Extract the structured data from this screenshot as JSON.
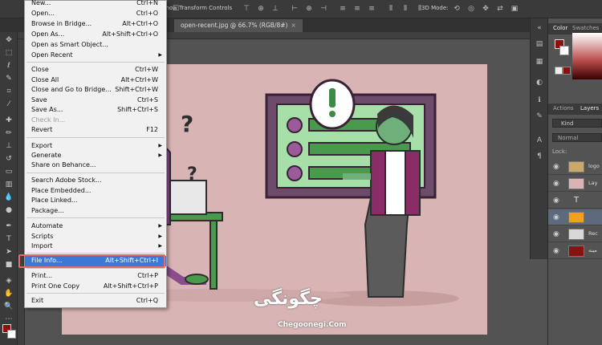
{
  "options_bar": {
    "label": "Show Transform Controls",
    "mode3d": "3D Mode:"
  },
  "document_tab": {
    "label": "open-recent.jpg @ 66.7% (RGB/8#)",
    "close": "×"
  },
  "file_menu": {
    "items": [
      {
        "label": "New...",
        "shortcut": "Ctrl+N"
      },
      {
        "label": "Open...",
        "shortcut": "Ctrl+O"
      },
      {
        "label": "Browse in Bridge...",
        "shortcut": "Alt+Ctrl+O"
      },
      {
        "label": "Open As...",
        "shortcut": "Alt+Shift+Ctrl+O"
      },
      {
        "label": "Open as Smart Object...",
        "shortcut": ""
      },
      {
        "label": "Open Recent",
        "shortcut": "",
        "submenu": true
      },
      {
        "label": "Close",
        "shortcut": "Ctrl+W"
      },
      {
        "label": "Close All",
        "shortcut": "Alt+Ctrl+W"
      },
      {
        "label": "Close and Go to Bridge...",
        "shortcut": "Shift+Ctrl+W"
      },
      {
        "label": "Save",
        "shortcut": "Ctrl+S"
      },
      {
        "label": "Save As...",
        "shortcut": "Shift+Ctrl+S"
      },
      {
        "label": "Check In...",
        "shortcut": "",
        "disabled": true
      },
      {
        "label": "Revert",
        "shortcut": "F12"
      },
      {
        "label": "Export",
        "shortcut": "",
        "submenu": true
      },
      {
        "label": "Generate",
        "shortcut": "",
        "submenu": true
      },
      {
        "label": "Share on Behance...",
        "shortcut": ""
      },
      {
        "label": "Search Adobe Stock...",
        "shortcut": ""
      },
      {
        "label": "Place Embedded...",
        "shortcut": ""
      },
      {
        "label": "Place Linked...",
        "shortcut": ""
      },
      {
        "label": "Package...",
        "shortcut": ""
      },
      {
        "label": "Automate",
        "shortcut": "",
        "submenu": true
      },
      {
        "label": "Scripts",
        "shortcut": "",
        "submenu": true
      },
      {
        "label": "Import",
        "shortcut": "",
        "submenu": true
      },
      {
        "label": "File Info...",
        "shortcut": "Alt+Shift+Ctrl+I",
        "highlighted": true
      },
      {
        "label": "Print...",
        "shortcut": "Ctrl+P"
      },
      {
        "label": "Print One Copy",
        "shortcut": "Alt+Shift+Ctrl+P"
      },
      {
        "label": "Exit",
        "shortcut": "Ctrl+Q"
      }
    ]
  },
  "panels": {
    "color_tab": "Color",
    "swatches_tab": "Swatches",
    "actions_tab": "Actions",
    "layers_tab": "Layers",
    "kind": "Kind",
    "blend": "Normal",
    "lock": "Lock:",
    "layers": [
      {
        "name": "logo"
      },
      {
        "name": "Lay"
      },
      {
        "name": ""
      },
      {
        "name": ""
      },
      {
        "name": "Rec"
      },
      {
        "name": "مینه"
      }
    ]
  },
  "watermark": {
    "brand": "چگونگی",
    "url": "Chegoonegi.Com"
  },
  "colors": {
    "accent_red": "#8b1010",
    "highlight_blue": "#3c79d6",
    "menu_bg": "#f1f1f1",
    "canvas_pink": "#d8b4b4"
  }
}
